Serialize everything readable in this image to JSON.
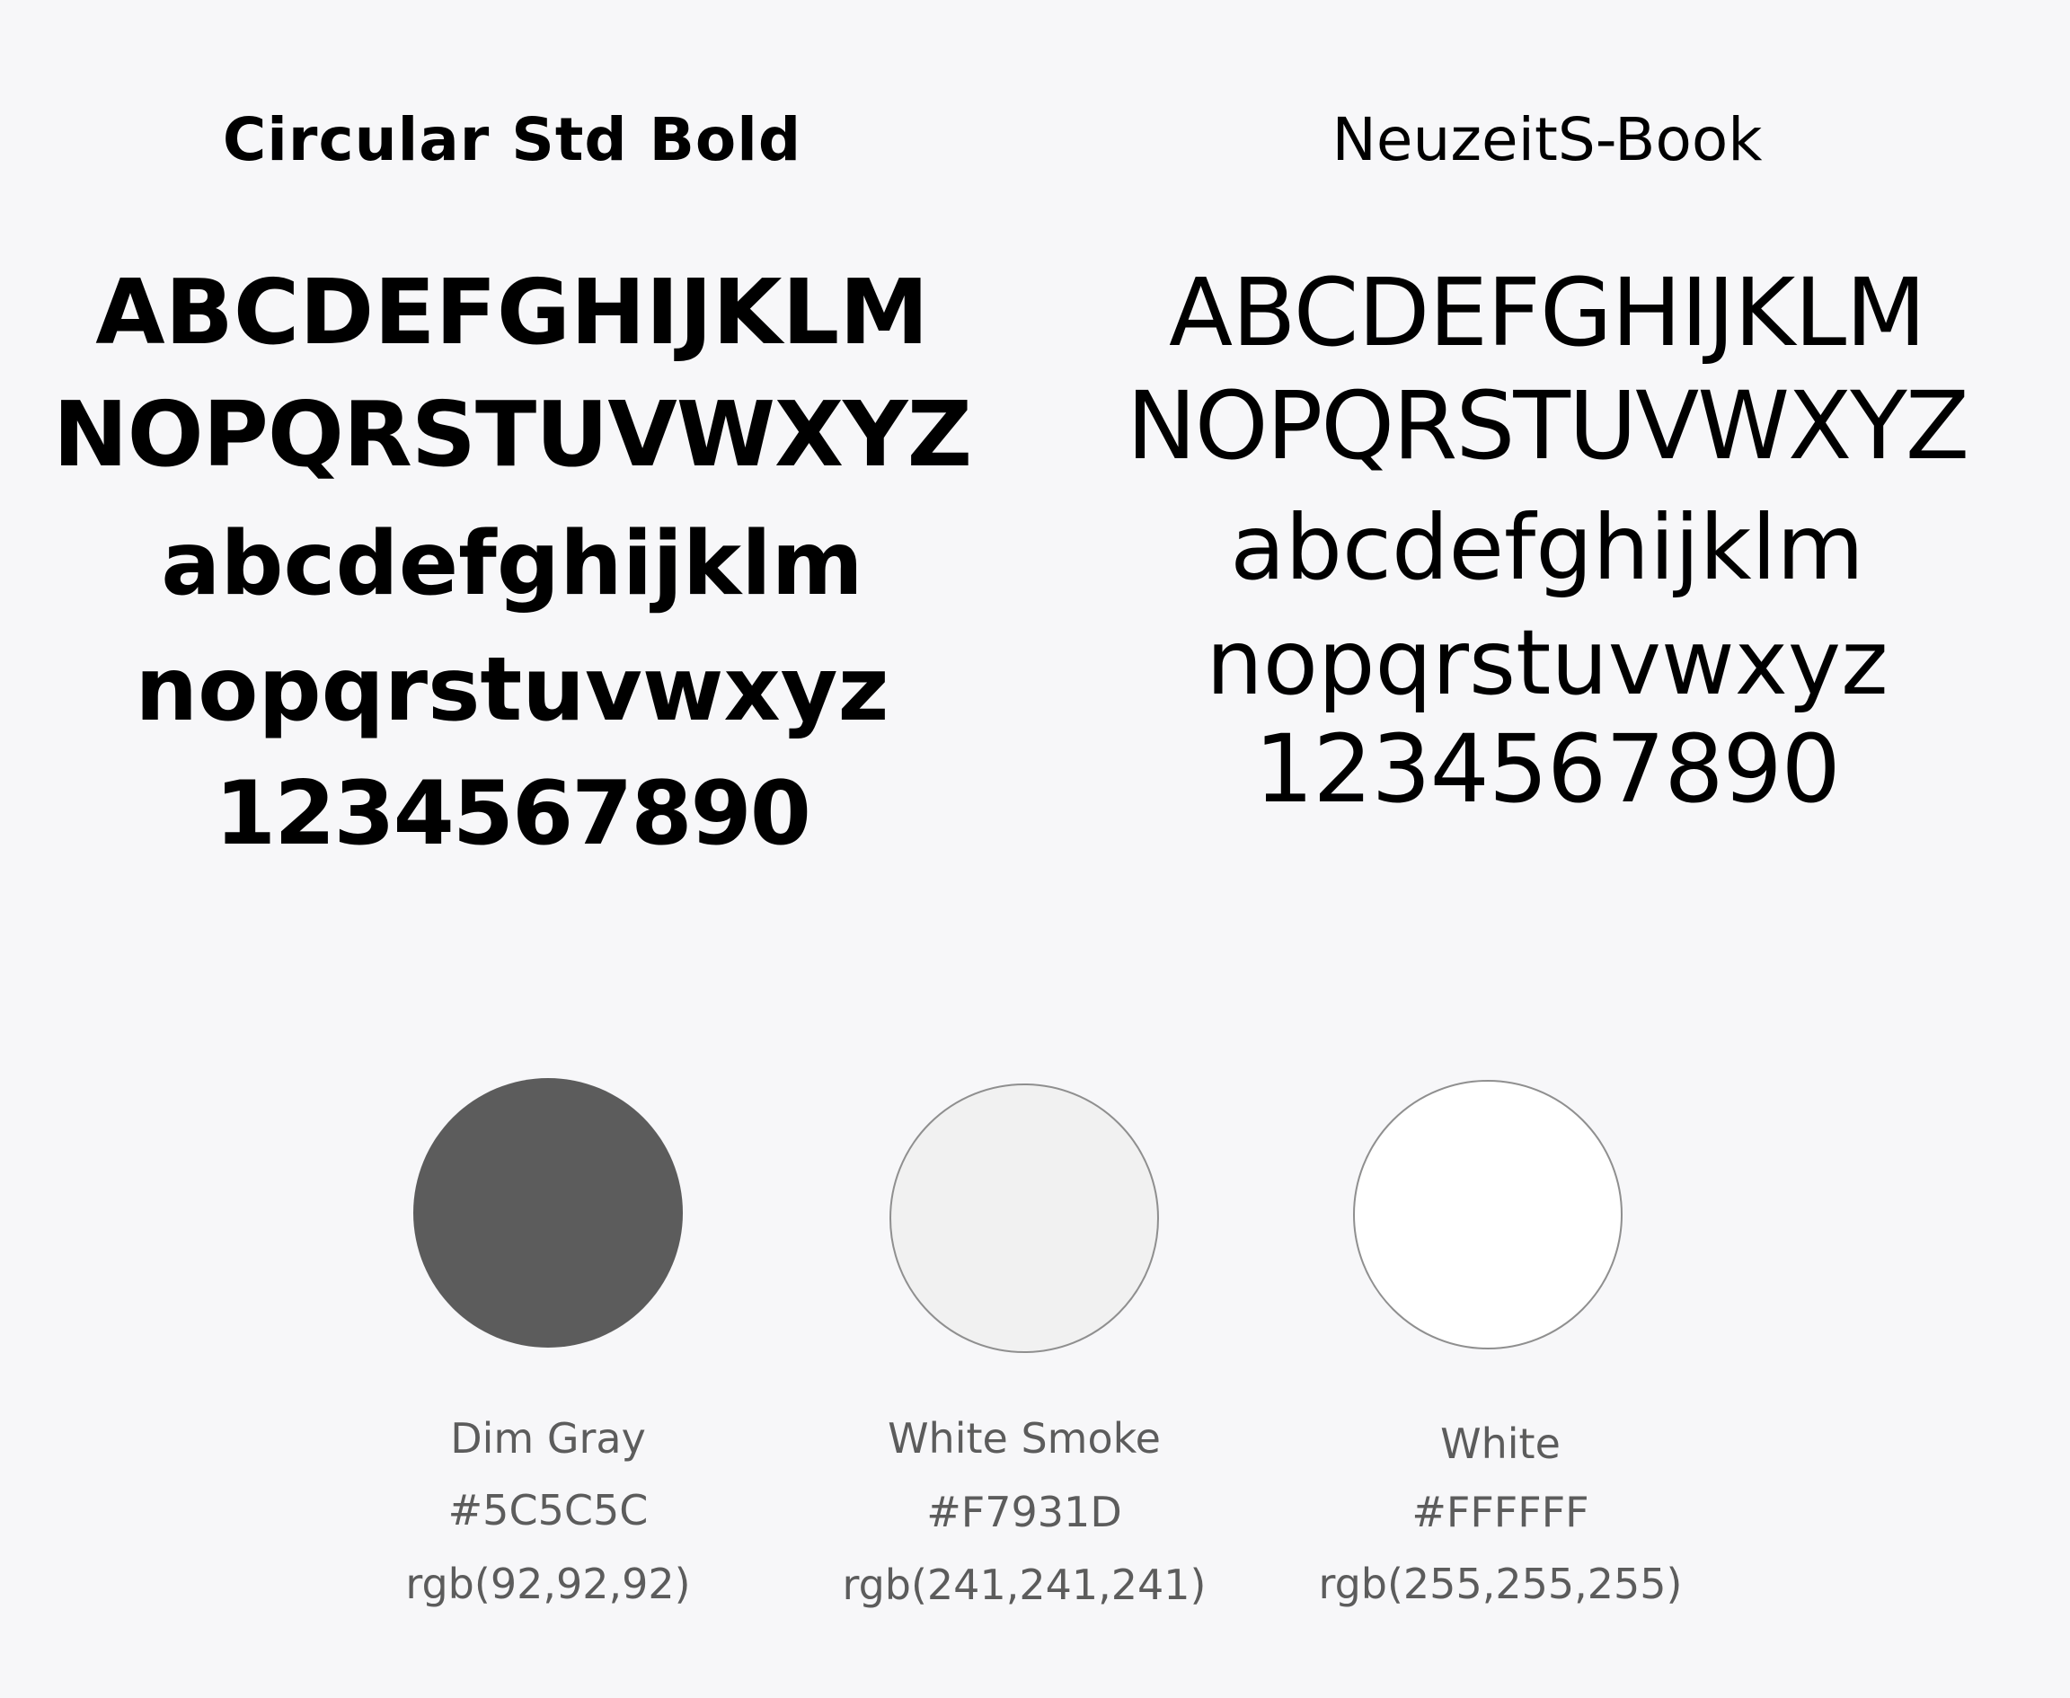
{
  "fonts": [
    {
      "name": "Circular Std Bold",
      "specimen": {
        "upper1": "ABCDEFGHIJKLM",
        "upper2": "NOPQRSTUVWXYZ",
        "lower1": "abcdefghijklm",
        "lower2": "nopqrstuvwxyz",
        "numbers": "1234567890"
      }
    },
    {
      "name": "NeuzeitS-Book",
      "specimen": {
        "upper1": "ABCDEFGHIJKLM",
        "upper2": "NOPQRSTUVWXYZ",
        "lower1": "abcdefghijklm",
        "lower2": "nopqrstuvwxyz",
        "numbers": "1234567890"
      }
    }
  ],
  "colors": [
    {
      "name": "Dim Gray",
      "hex": "#5C5C5C",
      "rgb": "rgb(92,92,92)",
      "swatch_fill": "#5c5c5c"
    },
    {
      "name": "White Smoke",
      "hex": "#F7931D",
      "rgb": "rgb(241,241,241)",
      "swatch_fill": "#f1f1f1"
    },
    {
      "name": "White",
      "hex": "#FFFFFF",
      "rgb": "rgb(255,255,255)",
      "swatch_fill": "#ffffff"
    }
  ],
  "theme": {
    "background": "#f7f7f9",
    "label_color": "#5c5c5c",
    "text_color": "#000000"
  }
}
